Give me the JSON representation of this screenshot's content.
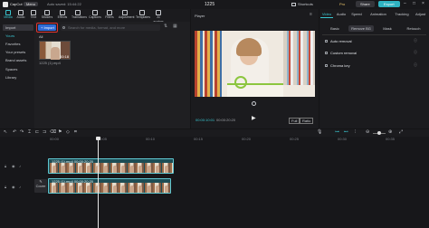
{
  "titlebar": {
    "app_name": "CapCut",
    "menu_label": "Menu",
    "autosave_text": "Auto saved: 15:44:22",
    "project_title": "1225",
    "shortcuts_label": "Shortcuts",
    "pro_label": "Pro",
    "share_label": "Share",
    "export_label": "Export"
  },
  "toolbar": {
    "items": [
      "Media",
      "Audio",
      "Text",
      "Stickers",
      "Effects",
      "Transitions",
      "Captions",
      "Filters",
      "Adjustment",
      "Templates",
      "AI avatars"
    ]
  },
  "sidebar": {
    "items": [
      "Import",
      "Yours",
      "Favorites",
      "Your presets",
      "Brand assets",
      "Spaces",
      "Library"
    ]
  },
  "media": {
    "import_label": "Import",
    "search_placeholder": "Search for media, format, and more",
    "filter_label": "All",
    "clip_name": "1225 (1).mp4",
    "clip_duration": "00:18"
  },
  "player": {
    "title": "Player",
    "timecode_current": "00:00:10:01",
    "timecode_total": "00:00:20:20",
    "controls_full": "Full",
    "controls_ratio": "Ratio"
  },
  "right_panel": {
    "tabs": [
      "Video",
      "Audio",
      "Speed",
      "Animation",
      "Tracking",
      "Adjust"
    ],
    "subtabs": [
      "Basic",
      "Remove BG",
      "Mask",
      "Retouch"
    ],
    "options": [
      "Auto removal",
      "Custom removal",
      "Chroma key"
    ]
  },
  "timeline": {
    "ruler_marks": [
      "00:00",
      "00:05",
      "00:10",
      "00:15",
      "00:20",
      "00:25",
      "00:30",
      "00:35"
    ],
    "clip1_label": "1225 (1).mp4 00:00:20:20",
    "clip2_label": "1225 (1).mp4 00:00:20:20",
    "cover_label": "Cover",
    "accent": "#39c5cf",
    "import_button_color": "#2f6bd6",
    "highlight_color": "#e0332f"
  }
}
